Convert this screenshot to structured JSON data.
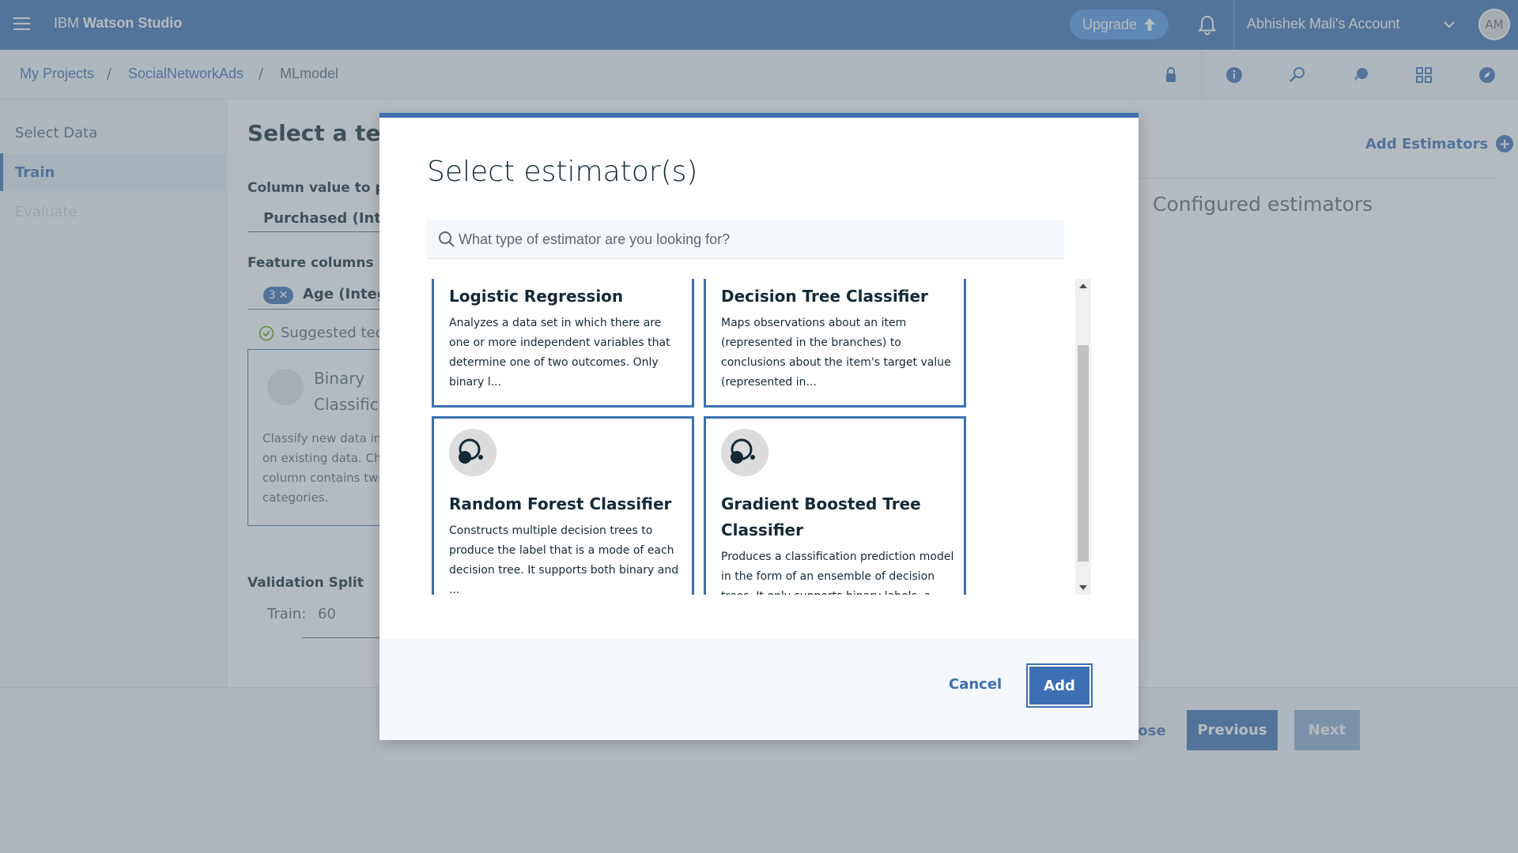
{
  "topbar": {
    "brand_prefix": "IBM ",
    "brand_name": "Watson Studio",
    "upgrade_label": "Upgrade",
    "account_name": "Abhishek Mali's Account",
    "avatar_initials": "AM"
  },
  "breadcrumb": {
    "items": [
      "My Projects",
      "SocialNetworkAds",
      "MLmodel"
    ],
    "separator": "/"
  },
  "leftnav": {
    "items": [
      {
        "label": "Select Data"
      },
      {
        "label": "Train"
      },
      {
        "label": "Evaluate"
      }
    ]
  },
  "main": {
    "title": "Select a technique",
    "column_label": "Column value to predict",
    "column_value": "Purchased (Integer)",
    "feature_label": "Feature columns",
    "feature_count": "3",
    "feature_value": "Age (Integer)",
    "suggested": "Suggested technique",
    "tech_title": "Binary Classification",
    "tech_desc": "Classify new data into categories based on existing data. Choose if your label column contains two distinct categories.",
    "validation_label": "Validation Split",
    "train_label": "Train:",
    "train_value": "60",
    "add_estimators": "Add Estimators",
    "configured": "Configured estimators"
  },
  "footer": {
    "close_label": "Close",
    "previous_label": "Previous",
    "next_label": "Next"
  },
  "modal": {
    "title": "Select estimator(s)",
    "search_placeholder": "What type of estimator are you looking for?",
    "estimators": [
      {
        "title": "Logistic Regression",
        "desc": "Analyzes a data set in which there are one or more independent variables that determine one of two outcomes. Only binary l..."
      },
      {
        "title": "Decision Tree Classifier",
        "desc": "Maps observations about an item (represented in the branches) to conclusions about the item's target value (represented in..."
      },
      {
        "title": "Random Forest Classifier",
        "desc": "Constructs multiple decision trees to produce the label that is a mode of each decision tree. It supports both binary and ..."
      },
      {
        "title": "Gradient Boosted Tree Classifier",
        "desc": "Produces a classification prediction model in the form of an ensemble of decision trees. It only supports binary labels, a..."
      }
    ],
    "cancel_label": "Cancel",
    "add_label": "Add"
  },
  "colors": {
    "accent": "#3d70b2",
    "text": "#152935",
    "muted": "#5a6872"
  }
}
